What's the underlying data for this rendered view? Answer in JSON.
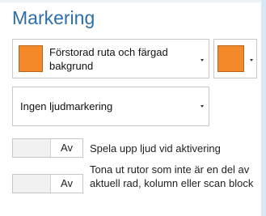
{
  "title": "Markering",
  "highlight": {
    "style_label": "Förstorad ruta och färgad bakgrund",
    "color": "#f4892a",
    "color_picker_label": ""
  },
  "sound": {
    "selected": "Ingen ljudmarkering"
  },
  "toggles": [
    {
      "state_label": "Av",
      "description": "Spela upp ljud vid aktivering"
    },
    {
      "state_label": "Av",
      "description": "Tona ut rutor som inte är en del av aktuell rad, kolumn eller scan block"
    }
  ]
}
